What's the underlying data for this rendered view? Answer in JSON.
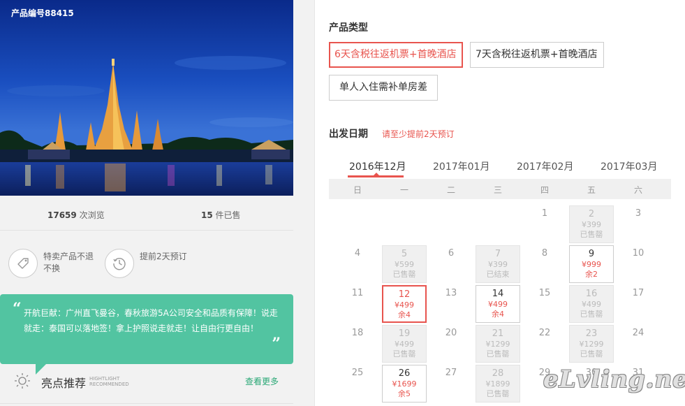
{
  "product": {
    "number_label": "产品编号88415",
    "views_count": "17659",
    "views_label": " 次浏览",
    "sold_count": "15",
    "sold_label": " 件已售"
  },
  "features": [
    {
      "icon": "tag-icon",
      "text": "特卖产品不退不换"
    },
    {
      "icon": "clock-icon",
      "text": "提前2天预订"
    }
  ],
  "highlight": {
    "quote": "开航巨献：广州直飞曼谷，春秋旅游5A公司安全和品质有保障！说走就走：泰国可以落地签！拿上护照说走就走！让自由行更自由！",
    "title": "亮点推荐",
    "en_1": "HIGHTLIGHT",
    "en_2": "RECOMMENDED",
    "more": "查看更多"
  },
  "product_type": {
    "title": "产品类型",
    "options": [
      {
        "label": "6天含税往返机票+首晚酒店",
        "selected": true
      },
      {
        "label": "7天含税往返机票+首晚酒店",
        "selected": false
      },
      {
        "label": "单人入住需补单房差",
        "selected": false
      }
    ]
  },
  "departure": {
    "title": "出发日期",
    "hint": "请至少提前2天预订",
    "months": [
      "2016年12月",
      "2017年01月",
      "2017年02月",
      "2017年03月"
    ],
    "active_month": "2016年12月",
    "weekdays": [
      "日",
      "一",
      "二",
      "三",
      "四",
      "五",
      "六"
    ],
    "days": [
      {
        "day": "1",
        "state": "plain"
      },
      {
        "day": "2",
        "state": "gray",
        "price": "¥399",
        "status": "已售罄"
      },
      {
        "day": "3",
        "state": "plain"
      },
      {
        "day": "4",
        "state": "plain"
      },
      {
        "day": "5",
        "state": "gray",
        "price": "¥599",
        "status": "已售罄"
      },
      {
        "day": "6",
        "state": "plain"
      },
      {
        "day": "7",
        "state": "gray",
        "price": "¥399",
        "status": "已结束"
      },
      {
        "day": "8",
        "state": "plain"
      },
      {
        "day": "9",
        "state": "avail",
        "price": "¥999",
        "status": "余2"
      },
      {
        "day": "10",
        "state": "plain"
      },
      {
        "day": "11",
        "state": "plain"
      },
      {
        "day": "12",
        "state": "picked",
        "price": "¥499",
        "status": "余4"
      },
      {
        "day": "13",
        "state": "plain"
      },
      {
        "day": "14",
        "state": "avail",
        "price": "¥499",
        "status": "余4"
      },
      {
        "day": "15",
        "state": "plain"
      },
      {
        "day": "16",
        "state": "gray",
        "price": "¥499",
        "status": "已售罄"
      },
      {
        "day": "17",
        "state": "plain"
      },
      {
        "day": "18",
        "state": "plain"
      },
      {
        "day": "19",
        "state": "gray",
        "price": "¥499",
        "status": "已售罄"
      },
      {
        "day": "20",
        "state": "plain"
      },
      {
        "day": "21",
        "state": "gray",
        "price": "¥1299",
        "status": "已售罄"
      },
      {
        "day": "22",
        "state": "plain"
      },
      {
        "day": "23",
        "state": "gray",
        "price": "¥1299",
        "status": "已售罄"
      },
      {
        "day": "24",
        "state": "plain"
      },
      {
        "day": "25",
        "state": "plain"
      },
      {
        "day": "26",
        "state": "avail",
        "price": "¥1699",
        "status": "余5"
      },
      {
        "day": "27",
        "state": "plain"
      },
      {
        "day": "28",
        "state": "gray",
        "price": "¥1899",
        "status": "已售罄"
      },
      {
        "day": "29",
        "state": "plain"
      },
      {
        "day": "30",
        "state": "plain"
      },
      {
        "day": "31",
        "state": "plain"
      }
    ]
  },
  "watermark": "eLvling.net",
  "colors": {
    "accent": "#e8544e",
    "green": "#52c4a1",
    "link_green": "#2aa876"
  }
}
